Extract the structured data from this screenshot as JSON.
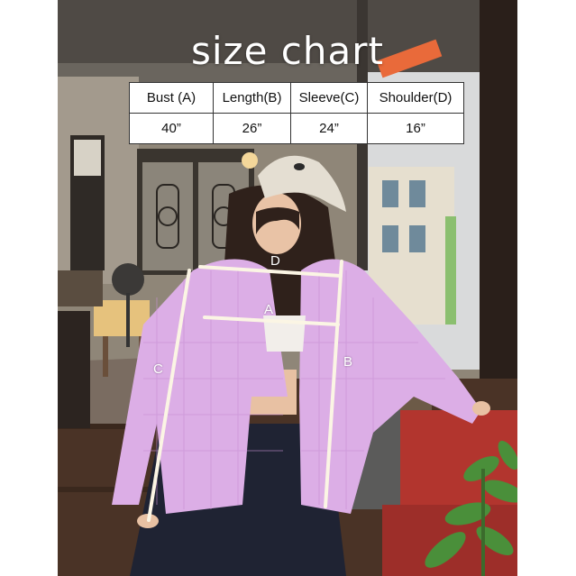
{
  "title": "size chart",
  "table": {
    "headers": [
      "Bust (A)",
      "Length(B)",
      "Sleeve(C)",
      "Shoulder(D)"
    ],
    "values": [
      "40”",
      "26”",
      "24”",
      "16”"
    ]
  },
  "measure_labels": {
    "a": "A",
    "b": "B",
    "c": "C",
    "d": "D"
  },
  "colors": {
    "background": "#ffffff",
    "shirt": "#dcaee6",
    "pants": "#1f2333",
    "cap": "#e4ded2",
    "measure_lines": "#fbf5e4"
  }
}
